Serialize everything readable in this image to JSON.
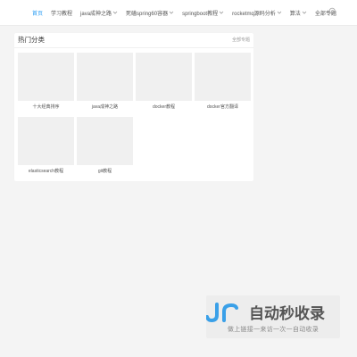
{
  "nav": {
    "items": [
      {
        "label": "首页",
        "active": true
      },
      {
        "label": "学习教程",
        "active": false
      },
      {
        "label": "java成神之路",
        "active": false
      },
      {
        "label": "死磕spring60容器",
        "active": false
      },
      {
        "label": "springboot教程",
        "active": false
      },
      {
        "label": "rocketmq源码分析",
        "active": false
      },
      {
        "label": "算法",
        "active": false
      },
      {
        "label": "全部专题",
        "active": false
      }
    ],
    "search_icon": "search-icon"
  },
  "section": {
    "title": "热门分类",
    "more_label": "全部专题",
    "tiles": [
      {
        "label": "十大经典排序"
      },
      {
        "label": "java成神之路"
      },
      {
        "label": "docker教程"
      },
      {
        "label": "docker官方翻译"
      },
      {
        "label": "elasticsearch教程"
      },
      {
        "label": "git教程"
      }
    ]
  },
  "watermark": {
    "brand": "自动秒收录",
    "tagline": "做上链接一来访一次一自动收录"
  },
  "colors": {
    "accent": "#2a9df4",
    "thumb_placeholder": "#f0f0f0",
    "watermark_blue": "#3aa0e8"
  }
}
